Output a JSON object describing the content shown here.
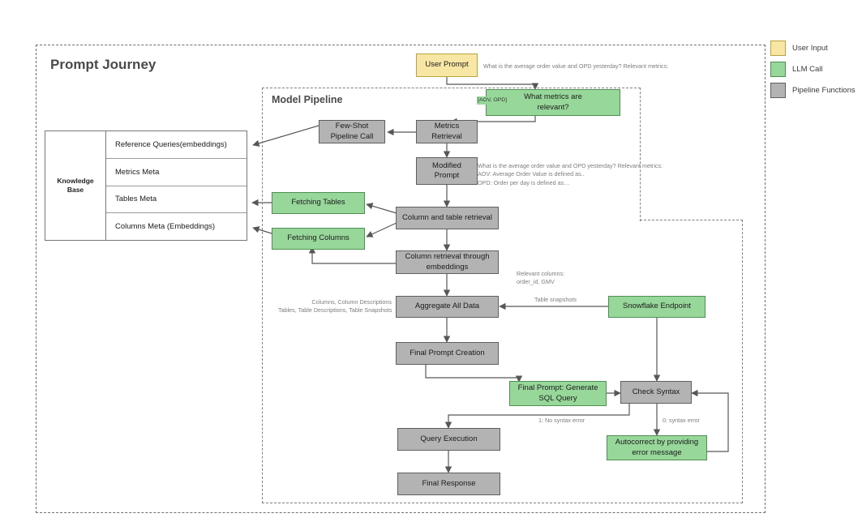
{
  "diagram": {
    "outer_title": "Prompt Journey",
    "inner_title": "Model Pipeline"
  },
  "legend": {
    "items": [
      {
        "label": "User Input",
        "color": "#f7e6a4",
        "kind": "yellow"
      },
      {
        "label": "LLM Call",
        "color": "#97d89a",
        "kind": "green"
      },
      {
        "label": "Pipeline Functions",
        "color": "#b3b3b3",
        "kind": "gray"
      }
    ]
  },
  "knowledge_base": {
    "label": "Knowledge\nBase",
    "rows": [
      "Reference Queries(embeddings)",
      "Metrics Meta",
      "Tables Meta",
      "Columns Meta (Embeddings)"
    ]
  },
  "nodes": {
    "user_prompt": "User Prompt",
    "what_metrics": "What metrics are\nrelevant?",
    "metrics_retrieval": "Metrics\nRetrieval",
    "few_shot": "Few-Shot\nPipeline Call",
    "modified_prompt": "Modified\nPrompt",
    "fetching_tables": "Fetching Tables",
    "fetching_columns": "Fetching Columns",
    "column_table_retrieval": "Column and table retrieval",
    "column_retrieval_embeddings": "Column retrieval through\nembeddings",
    "aggregate_all_data": "Aggregate All Data",
    "snowflake_endpoint": "Snowflake Endpoint",
    "final_prompt_creation": "Final Prompt Creation",
    "final_prompt_generate_sql": "Final Prompt: Generate\nSQL Query",
    "check_syntax": "Check Syntax",
    "query_execution": "Query Execution",
    "final_response": "Final Response",
    "autocorrect": "Autocorrect by providing\nerror message"
  },
  "annotations": {
    "user_prompt_text": "What is the average order value and OPD yesterday? Relevant metrics:",
    "aov_opd_tag": "[AOV, OPD]",
    "modified_prompt_text": "What is the average order value and OPD yesterday? Relevant metrics:\nAOV: Average Order Value is defined as..\nOPD: Order per day is defined as…",
    "relevant_columns": "Relevant columns:\norder_id, GMV",
    "table_snapshots": "Table snapshots",
    "aggregate_inputs": "Columns, Column Descriptions\nTables, Table Descriptions, Table Snapshots",
    "no_syntax_error": "1: No syntax error",
    "syntax_error": "0: syntax error"
  },
  "colors": {
    "user_input": "#f7e6a4",
    "llm_call": "#97d89a",
    "pipeline_function": "#b3b3b3",
    "connector": "#575757",
    "annotation_text": "#7d7d7d",
    "dashed_border": "#707070"
  }
}
